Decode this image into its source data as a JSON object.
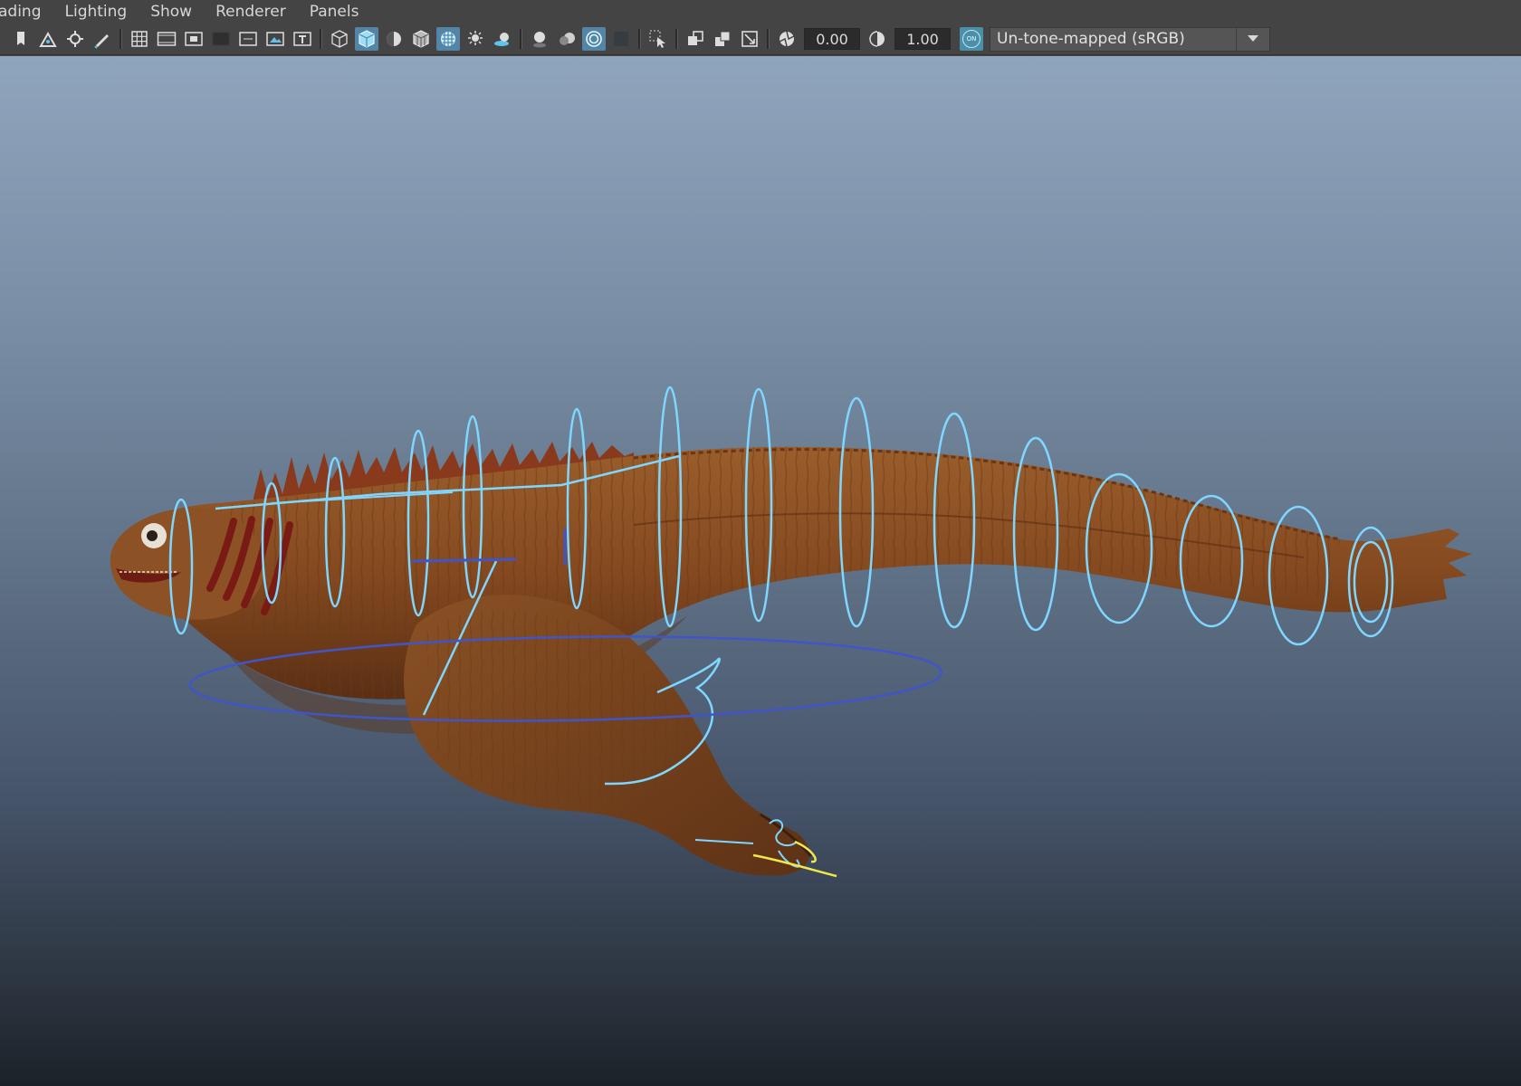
{
  "menu": {
    "items": [
      "ading",
      "Lighting",
      "Show",
      "Renderer",
      "Panels"
    ]
  },
  "toolbar": {
    "exposure_value": "0.00",
    "gamma_value": "1.00",
    "color_management_badge": "ON",
    "view_transform": "Un-tone-mapped (sRGB)"
  },
  "viewport": {
    "scene_content": "rigged-creature",
    "background_gradient": [
      "#8fa5bc",
      "#1c2229"
    ],
    "controller_color": "#7fd6ff",
    "secondary_controller_color": "#3f55c9",
    "selected_controller_color": "#f0e84a",
    "creature_color": "#8a5226"
  },
  "icons": {
    "active_color": "#5285a6"
  }
}
